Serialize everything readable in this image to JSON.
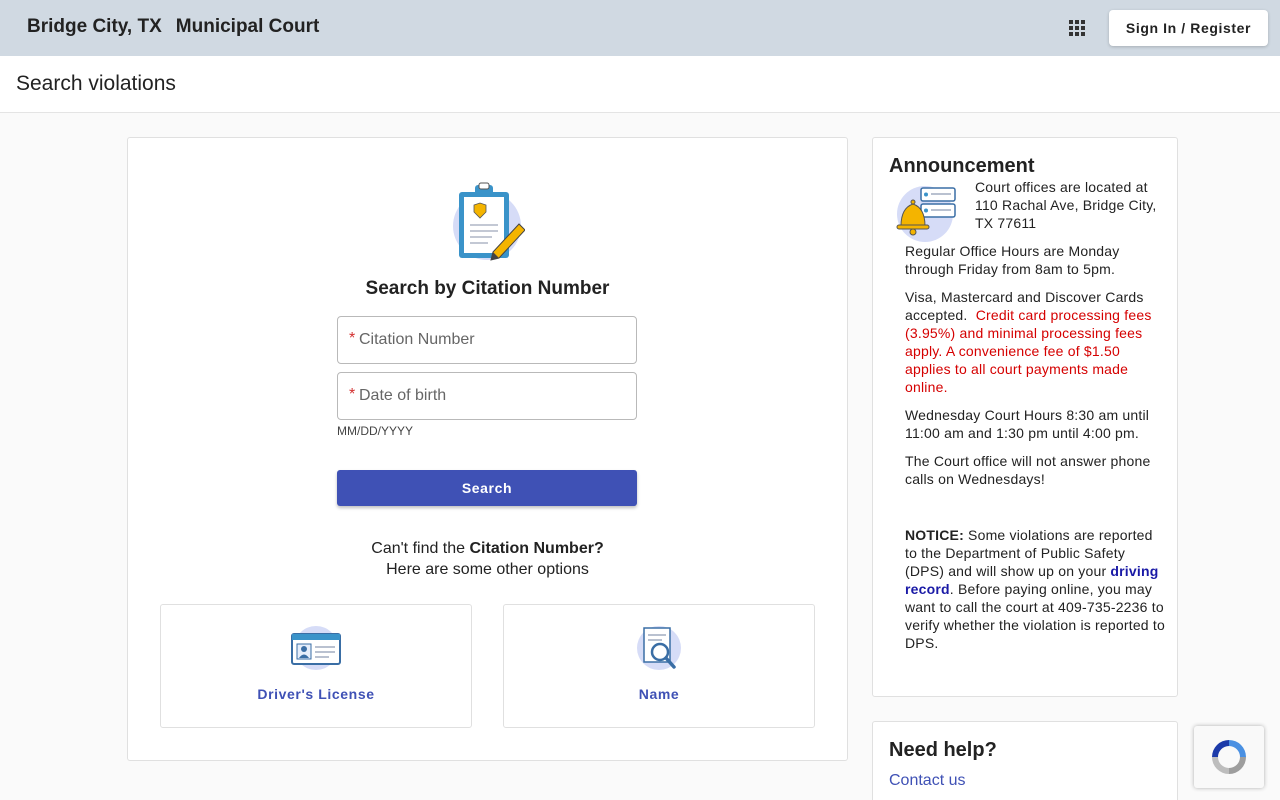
{
  "header": {
    "city": "Bridge City, TX",
    "court": "Municipal Court",
    "apps_icon": "apps-grid-icon",
    "signin_label": "Sign In / Register"
  },
  "page": {
    "title": "Search violations"
  },
  "search": {
    "title": "Search by Citation Number",
    "citation_placeholder": "Citation Number",
    "dob_placeholder": "Date of birth",
    "dob_hint": "MM/DD/YYYY",
    "required_mark": "*",
    "button_label": "Search",
    "cantfind_prefix": "Can't find the ",
    "cantfind_bold": "Citation Number?",
    "cantfind_line2": "Here are some other options",
    "options": [
      {
        "label": "Driver's License",
        "icon": "drivers-license-icon"
      },
      {
        "label": "Name",
        "icon": "name-search-icon"
      }
    ]
  },
  "announcement": {
    "title": "Announcement",
    "icon": "bell-announcement-icon",
    "p1": "Court offices are located at 110 Rachal Ave, Bridge City, TX 77611",
    "p2": "Regular Office Hours are Monday through Friday from 8am to 5pm.",
    "p3_normal": "Visa, Mastercard and Discover Cards accepted.",
    "p3_red": "Credit card processing fees (3.95%) and minimal processing fees apply.  A convenience fee of $1.50 applies to all court payments made online.",
    "p4": "Wednesday Court Hours 8:30 am until 11:00 am and 1:30 pm until 4:00 pm.",
    "p5": "The Court office will not answer phone calls on Wednesdays!",
    "notice_label": "NOTICE:",
    "notice_text1": "Some violations are reported to the Department of Public Safety (DPS) and will show up on your",
    "notice_link": "driving record",
    "notice_text2": ".  Before paying online, you may want to call the court at 409-735-2236 to verify whether the violation is reported to DPS."
  },
  "help": {
    "title": "Need help?",
    "link": "Contact us"
  },
  "colors": {
    "accent": "#3f51b5",
    "header_bg": "#d0d9e2",
    "warning_red": "#d50000",
    "link_blue": "#1a1aa6"
  }
}
